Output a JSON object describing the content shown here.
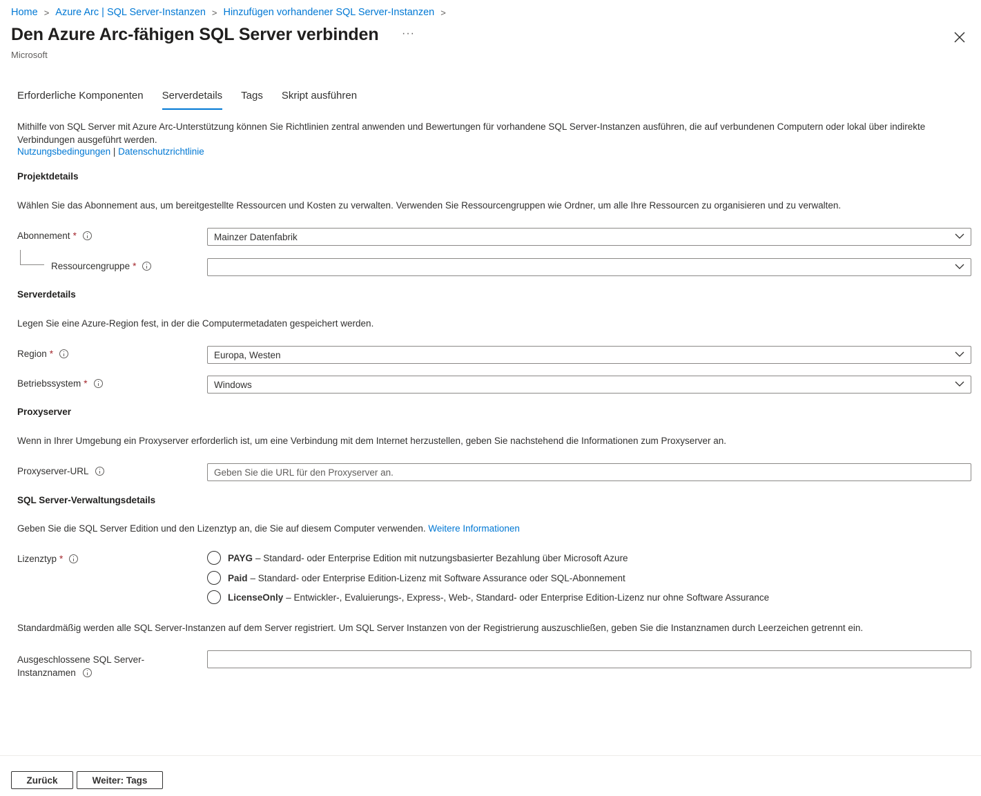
{
  "breadcrumb": [
    "Home",
    "Azure Arc | SQL Server-Instanzen",
    "Hinzufügen vorhandener SQL Server-Instanzen"
  ],
  "title": "Den Azure Arc-fähigen SQL Server verbinden",
  "more": "···",
  "publisher": "Microsoft",
  "tabs": [
    "Erforderliche Komponenten",
    "Serverdetails",
    "Tags",
    "Skript ausführen"
  ],
  "active_tab": "Serverdetails",
  "intro": "Mithilfe von SQL Server mit Azure Arc-Unterstützung können Sie Richtlinien zentral anwenden und Bewertungen für vorhandene SQL Server-Instanzen ausführen, die auf verbundenen Computern oder lokal über indirekte Verbindungen ausgeführt werden.",
  "links": {
    "terms": "Nutzungsbedingungen",
    "separator": "|",
    "privacy": "Datenschutzrichtlinie"
  },
  "project": {
    "heading": "Projektdetails",
    "desc": "Wählen Sie das Abonnement aus, um bereitgestellte Ressourcen und Kosten zu verwalten. Verwenden Sie Ressourcengruppen wie Ordner, um alle Ihre Ressourcen zu organisieren und zu verwalten.",
    "subscription_label": "Abonnement",
    "subscription_value": "Mainzer Datenfabrik",
    "resource_group_label": "Ressourcengruppe",
    "resource_group_value": ""
  },
  "server": {
    "heading": "Serverdetails",
    "desc": "Legen Sie eine Azure-Region fest, in der die Computermetadaten gespeichert werden.",
    "region_label": "Region",
    "region_value": "Europa, Westen",
    "os_label": "Betriebssystem",
    "os_value": "Windows"
  },
  "proxy": {
    "heading": "Proxyserver",
    "desc": "Wenn in Ihrer Umgebung ein Proxyserver erforderlich ist, um eine Verbindung mit dem Internet herzustellen, geben Sie nachstehend die Informationen zum Proxyserver an.",
    "url_label": "Proxyserver-URL",
    "url_placeholder": "Geben Sie die URL für den Proxyserver an."
  },
  "management": {
    "heading": "SQL Server-Verwaltungsdetails",
    "desc": "Geben Sie die SQL Server Edition und den Lizenztyp an, die Sie auf diesem Computer verwenden.",
    "more_info": "Weitere Informationen",
    "license_label": "Lizenztyp",
    "options": [
      {
        "name": "PAYG",
        "text": "– Standard- oder Enterprise Edition mit nutzungsbasierter Bezahlung über Microsoft Azure"
      },
      {
        "name": "Paid",
        "text": "– Standard- oder Enterprise Edition-Lizenz mit Software Assurance oder SQL-Abonnement"
      },
      {
        "name": "LicenseOnly",
        "text": "– Entwickler-, Evaluierungs-, Express-, Web-, Standard- oder Enterprise Edition-Lizenz nur ohne Software Assurance"
      }
    ],
    "exclude_desc": "Standardmäßig werden alle SQL Server-Instanzen auf dem Server registriert. Um SQL Server Instanzen von der Registrierung auszuschließen, geben Sie die Instanznamen durch Leerzeichen getrennt ein.",
    "exclude_label_line1": "Ausgeschlossene SQL Server-",
    "exclude_label_line2": "Instanznamen",
    "exclude_value": ""
  },
  "required_mark": "*",
  "footer": {
    "back": "Zurück",
    "next": "Weiter: Tags"
  }
}
